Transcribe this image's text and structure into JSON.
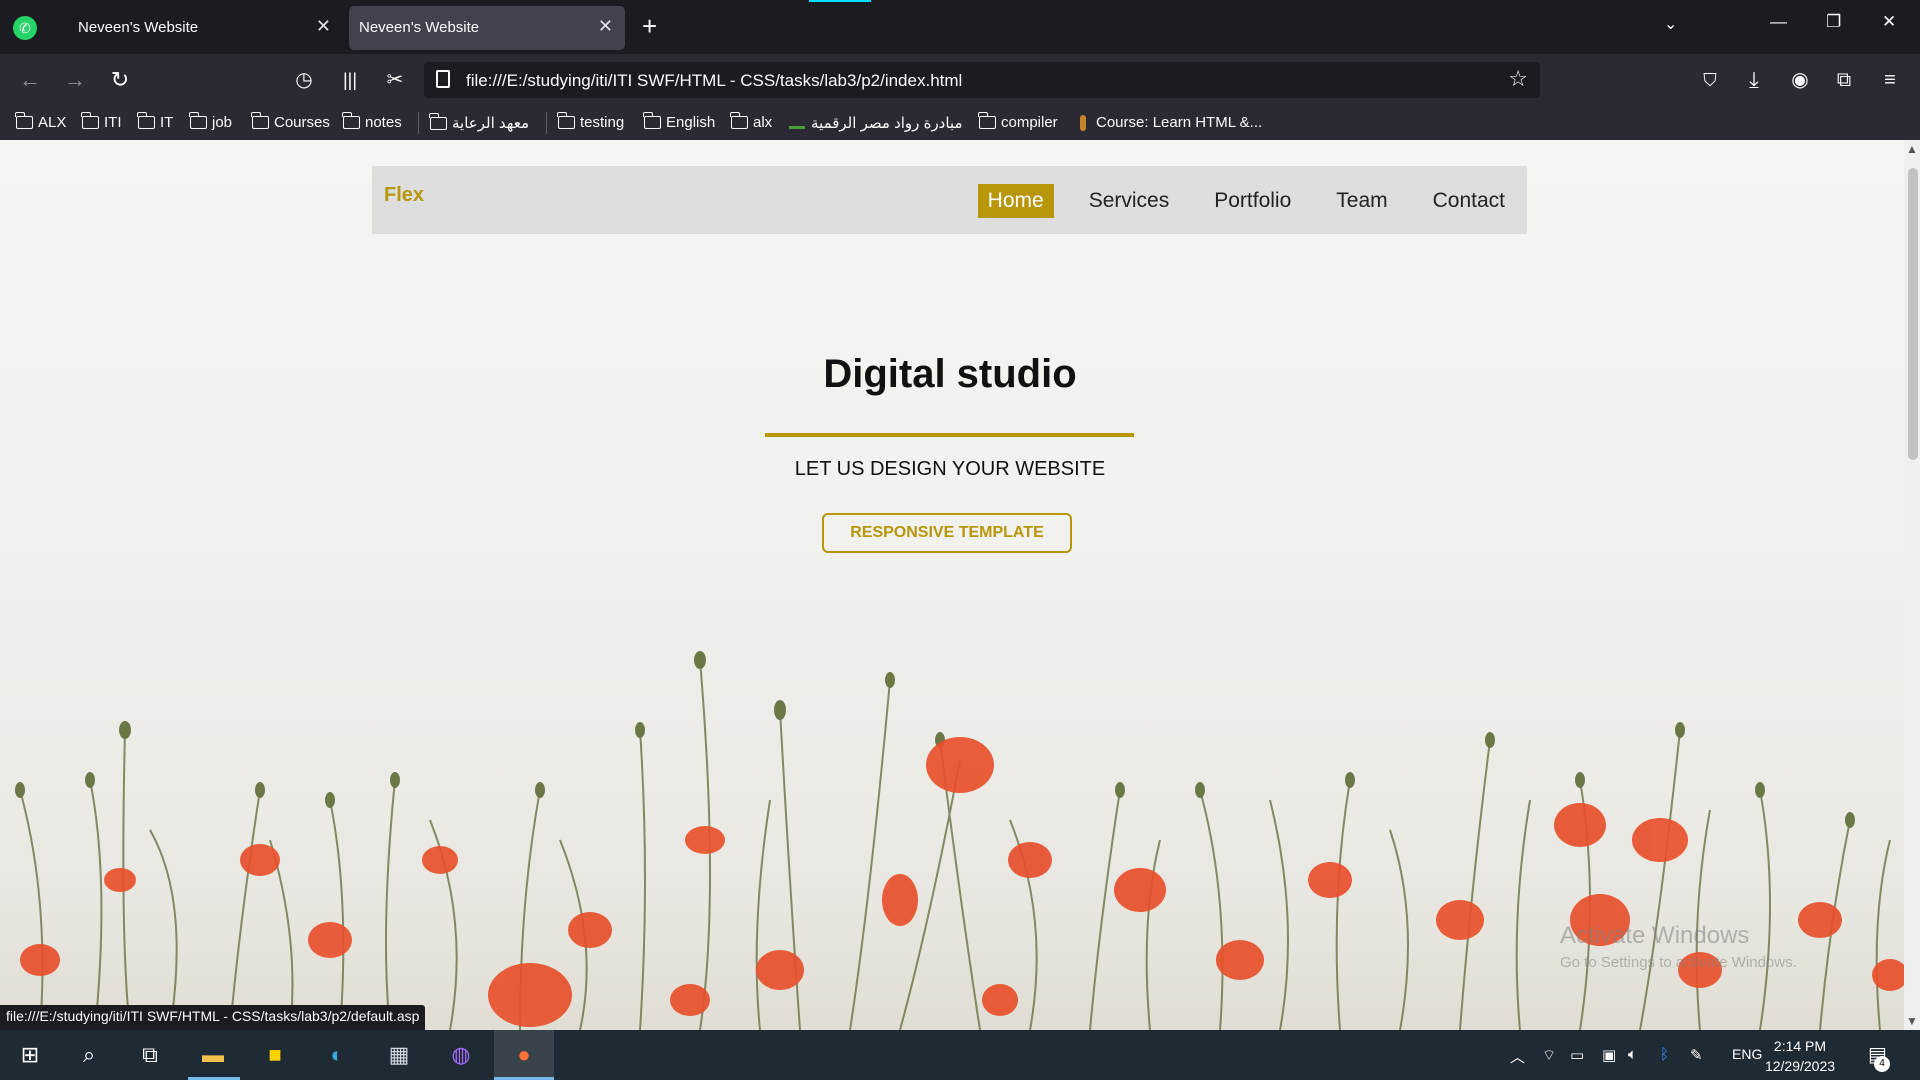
{
  "browser": {
    "tabs": [
      {
        "title": "Neveen's Website",
        "active": false
      },
      {
        "title": "Neveen's Website",
        "active": true
      }
    ],
    "new_tab_label": "+",
    "url": "file:///E:/studying/iti/ITI SWF/HTML - CSS/tasks/lab3/p2/index.html",
    "bookmarks": [
      {
        "label": "ALX",
        "type": "folder"
      },
      {
        "label": "ITI",
        "type": "folder"
      },
      {
        "label": "IT",
        "type": "folder"
      },
      {
        "label": "job",
        "type": "folder"
      },
      {
        "label": "Courses",
        "type": "folder"
      },
      {
        "label": "notes",
        "type": "folder"
      },
      {
        "label": "معهد الرعاية",
        "type": "folder"
      },
      {
        "label": "testing",
        "type": "folder"
      },
      {
        "label": "English",
        "type": "folder"
      },
      {
        "label": "alx",
        "type": "folder"
      },
      {
        "label": "مبادرة رواد مصر الرقمية",
        "type": "link"
      },
      {
        "label": "compiler",
        "type": "folder"
      },
      {
        "label": "Course: Learn HTML &...",
        "type": "link"
      }
    ],
    "status_url": "file:///E:/studying/iti/ITI SWF/HTML - CSS/tasks/lab3/p2/default.asp"
  },
  "site": {
    "brand": "Flex",
    "menu": [
      "Home",
      "Services",
      "Portfolio",
      "Team",
      "Contact"
    ],
    "active_menu": "Home",
    "hero_title": "Digital studio",
    "hero_subtitle": "LET US DESIGN YOUR WEBSITE",
    "hero_button": "RESPONSIVE TEMPLATE",
    "accent_color": "#b8960a"
  },
  "watermark": {
    "line1": "Activate Windows",
    "line2": "Go to Settings to activate Windows."
  },
  "taskbar": {
    "language": "ENG",
    "time": "2:14 PM",
    "date": "12/29/2023",
    "notification_count": "4"
  }
}
